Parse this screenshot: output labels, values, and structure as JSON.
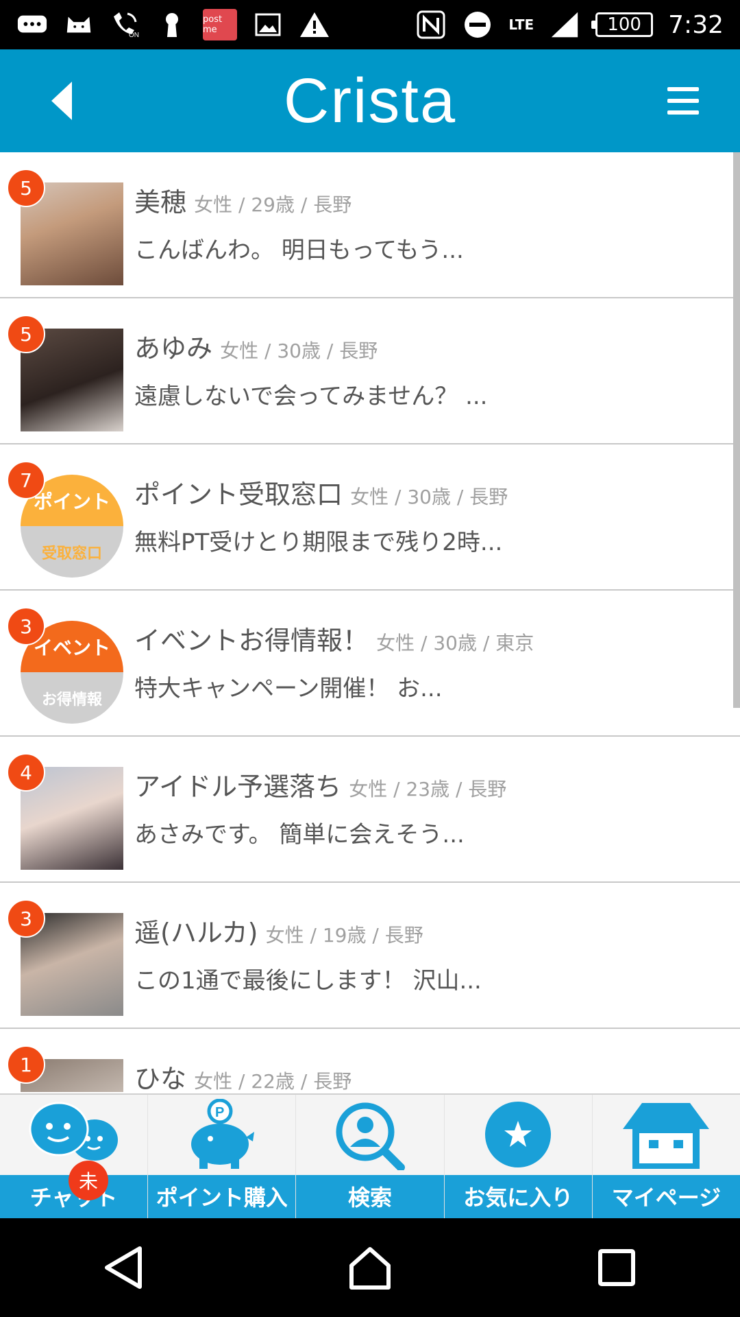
{
  "status_bar": {
    "postme_label": "post me",
    "network": "LTE",
    "battery": "100",
    "time": "7:32",
    "icons": [
      "chat-bubble-icon",
      "cat-icon",
      "wifi-calling-icon",
      "keyhole-icon",
      "postme-icon",
      "image-icon",
      "warning-icon",
      "nfc-icon",
      "do-not-disturb-icon",
      "signal-icon",
      "battery-icon"
    ]
  },
  "header": {
    "title": "Crista",
    "color": "#0097c8"
  },
  "list": {
    "items": [
      {
        "badge": "5",
        "name": "美穂",
        "meta": "女性 / 29歳 / 長野",
        "preview": "こんばんわ。 明日もってもう..."
      },
      {
        "badge": "5",
        "name": "あゆみ",
        "meta": "女性 / 30歳 / 長野",
        "preview": "遠慮しないで会ってみません？ ..."
      },
      {
        "badge": "7",
        "name": "ポイント受取窓口",
        "meta": "女性 / 30歳 / 長野",
        "preview": "無料PT受けとり期限まで残り2時...",
        "avatar_top": "ポイント",
        "avatar_bottom": "受取窓口"
      },
      {
        "badge": "3",
        "name": "イベントお得情報！",
        "meta": "女性 / 30歳 / 東京",
        "preview": "特大キャンペーン開催！ お...",
        "avatar_top": "イベント",
        "avatar_bottom": "お得情報"
      },
      {
        "badge": "4",
        "name": "アイドル予選落ち",
        "meta": "女性 / 23歳 / 長野",
        "preview": "あさみです。 簡単に会えそう..."
      },
      {
        "badge": "3",
        "name": "遥(ハルカ)",
        "meta": "女性 / 19歳 / 長野",
        "preview": "この1通で最後にします！ 沢山..."
      },
      {
        "badge": "1",
        "name": "ひな",
        "meta": "女性 / 22歳 / 長野",
        "preview": ""
      }
    ]
  },
  "bottom_nav": {
    "items": [
      {
        "label": "チャット",
        "icon": "chat-icon"
      },
      {
        "label": "ポイント購入",
        "icon": "piggy-bank-icon"
      },
      {
        "label": "検索",
        "icon": "search-user-icon"
      },
      {
        "label": "お気に入り",
        "icon": "star-icon"
      },
      {
        "label": "マイページ",
        "icon": "house-icon"
      }
    ],
    "unread_badge": "未",
    "accent": "#1aa0d8"
  },
  "colors": {
    "badge": "#f04a14",
    "point_avatar": "#fbb13c",
    "event_avatar": "#f36a1c"
  }
}
